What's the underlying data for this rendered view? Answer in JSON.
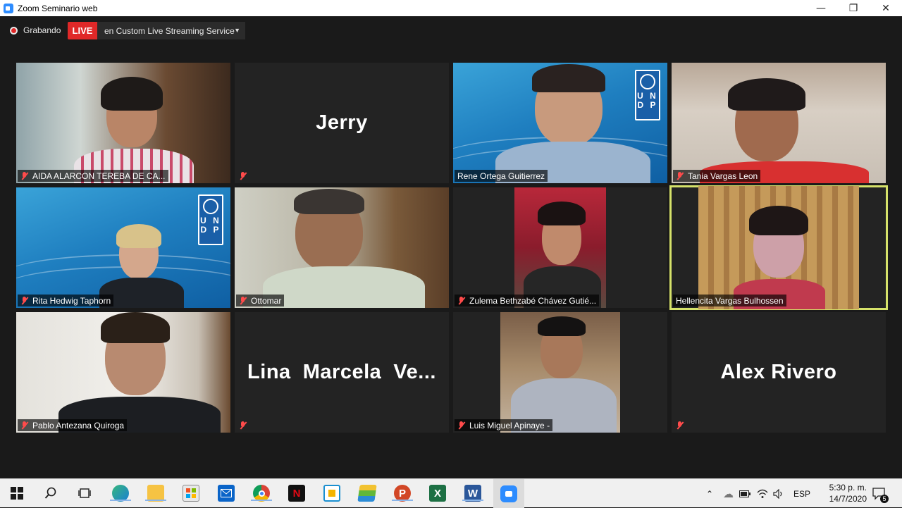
{
  "window": {
    "title": "Zoom Seminario web"
  },
  "recording": {
    "label": "Grabando",
    "live_badge": "LIVE",
    "stream_service": "en Custom Live Streaming Service"
  },
  "participants": [
    {
      "name": "AIDA ALARCON TEREBA DE CA...",
      "muted": true,
      "video": true
    },
    {
      "name": "Jerry",
      "muted": true,
      "video": false,
      "center_name": "Jerry"
    },
    {
      "name": "Rene Ortega Guitierrez",
      "muted": false,
      "video": true
    },
    {
      "name": "Tania Vargas Leon",
      "muted": true,
      "video": true
    },
    {
      "name": "Rita Hedwig Taphorn",
      "muted": true,
      "video": true
    },
    {
      "name": "Ottomar",
      "muted": true,
      "video": true
    },
    {
      "name": "Zulema Bethzabé Chávez Gutié...",
      "muted": true,
      "video": true
    },
    {
      "name": "Hellencita Vargas Bulhossen",
      "muted": false,
      "video": true,
      "active_speaker": true
    },
    {
      "name": "Pablo Antezana Quiroga",
      "muted": true,
      "video": true
    },
    {
      "name": "Lina Marcela Ve...",
      "muted": true,
      "video": false,
      "center_name": "Lina  Marcela  Ve..."
    },
    {
      "name": "Luis Miguel Apinaye -",
      "muted": true,
      "video": true
    },
    {
      "name": "Alex Rivero",
      "muted": true,
      "video": false,
      "center_name": "Alex Rivero"
    }
  ],
  "undp_logo": {
    "letters": "U N D P"
  },
  "taskbar": {
    "apps": [
      "windows-start",
      "search",
      "task-view",
      "edge",
      "file-explorer",
      "microsoft-store",
      "mail",
      "chrome",
      "netflix",
      "unknown-app",
      "bluestacks",
      "powerpoint",
      "excel",
      "word",
      "zoom"
    ],
    "language": "ESP",
    "time": "5:30 p. m.",
    "date": "14/7/2020",
    "notifications": "5"
  },
  "colors": {
    "active_speaker": "#d6e26a",
    "live": "#e02828",
    "muted": "#ff4b4b"
  }
}
